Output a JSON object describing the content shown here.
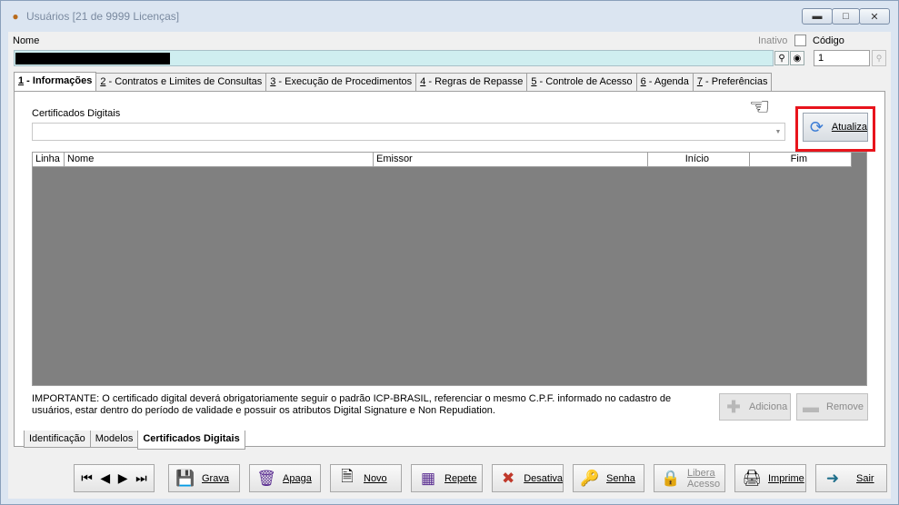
{
  "window": {
    "title": "Usuários [21 de 9999 Licenças]",
    "controls": [
      "minimize",
      "maximize",
      "close"
    ]
  },
  "header": {
    "nome_label": "Nome",
    "inativo_label": "Inativo",
    "inativo_checked": false,
    "codigo_label": "Código",
    "codigo_value": "1"
  },
  "tabs": [
    {
      "key": "1",
      "label": " - Informações",
      "active": true
    },
    {
      "key": "2",
      "label": " - Contratos e Limites de Consultas",
      "active": false
    },
    {
      "key": "3",
      "label": " - Execução de Procedimentos",
      "active": false
    },
    {
      "key": "4",
      "label": " - Regras de Repasse",
      "active": false
    },
    {
      "key": "5",
      "label": " - Controle de Acesso",
      "active": false
    },
    {
      "key": "6",
      "label": " - Agenda",
      "active": false
    },
    {
      "key": "7",
      "label": " - Preferências",
      "active": false
    }
  ],
  "certificados": {
    "label": "Certificados Digitais",
    "atualiza_label": "Atualiza",
    "columns": [
      "Linha",
      "Nome",
      "Emissor",
      "Início",
      "Fim"
    ],
    "rows": [],
    "note_line1": "IMPORTANTE: O certificado digital deverá obrigatoriamente seguir o padrão ICP-BRASIL, referenciar o mesmo C.P.F. informado no cadastro de",
    "note_line2": "usuários, estar dentro do período de validade e possuir os atributos Digital Signature e Non Repudiation.",
    "adiciona_label": "Adiciona",
    "remove_label": "Remove"
  },
  "subtabs": [
    {
      "label": "Identificação",
      "active": false
    },
    {
      "label": "Modelos",
      "active": false
    },
    {
      "label": "Certificados Digitais",
      "active": true
    }
  ],
  "toolbar": {
    "grava": "Grava",
    "apaga": "Apaga",
    "novo": "Novo",
    "repete": "Repete",
    "desativa": "Desativa",
    "senha": "Senha",
    "libera_line1": "Libera",
    "libera_line2": "Acesso",
    "imprime": "Imprime",
    "sair": "Sair"
  },
  "colors": {
    "highlight_border": "#e8141c",
    "nome_field_bg": "#cfeef0",
    "grid_bg": "#808080"
  }
}
